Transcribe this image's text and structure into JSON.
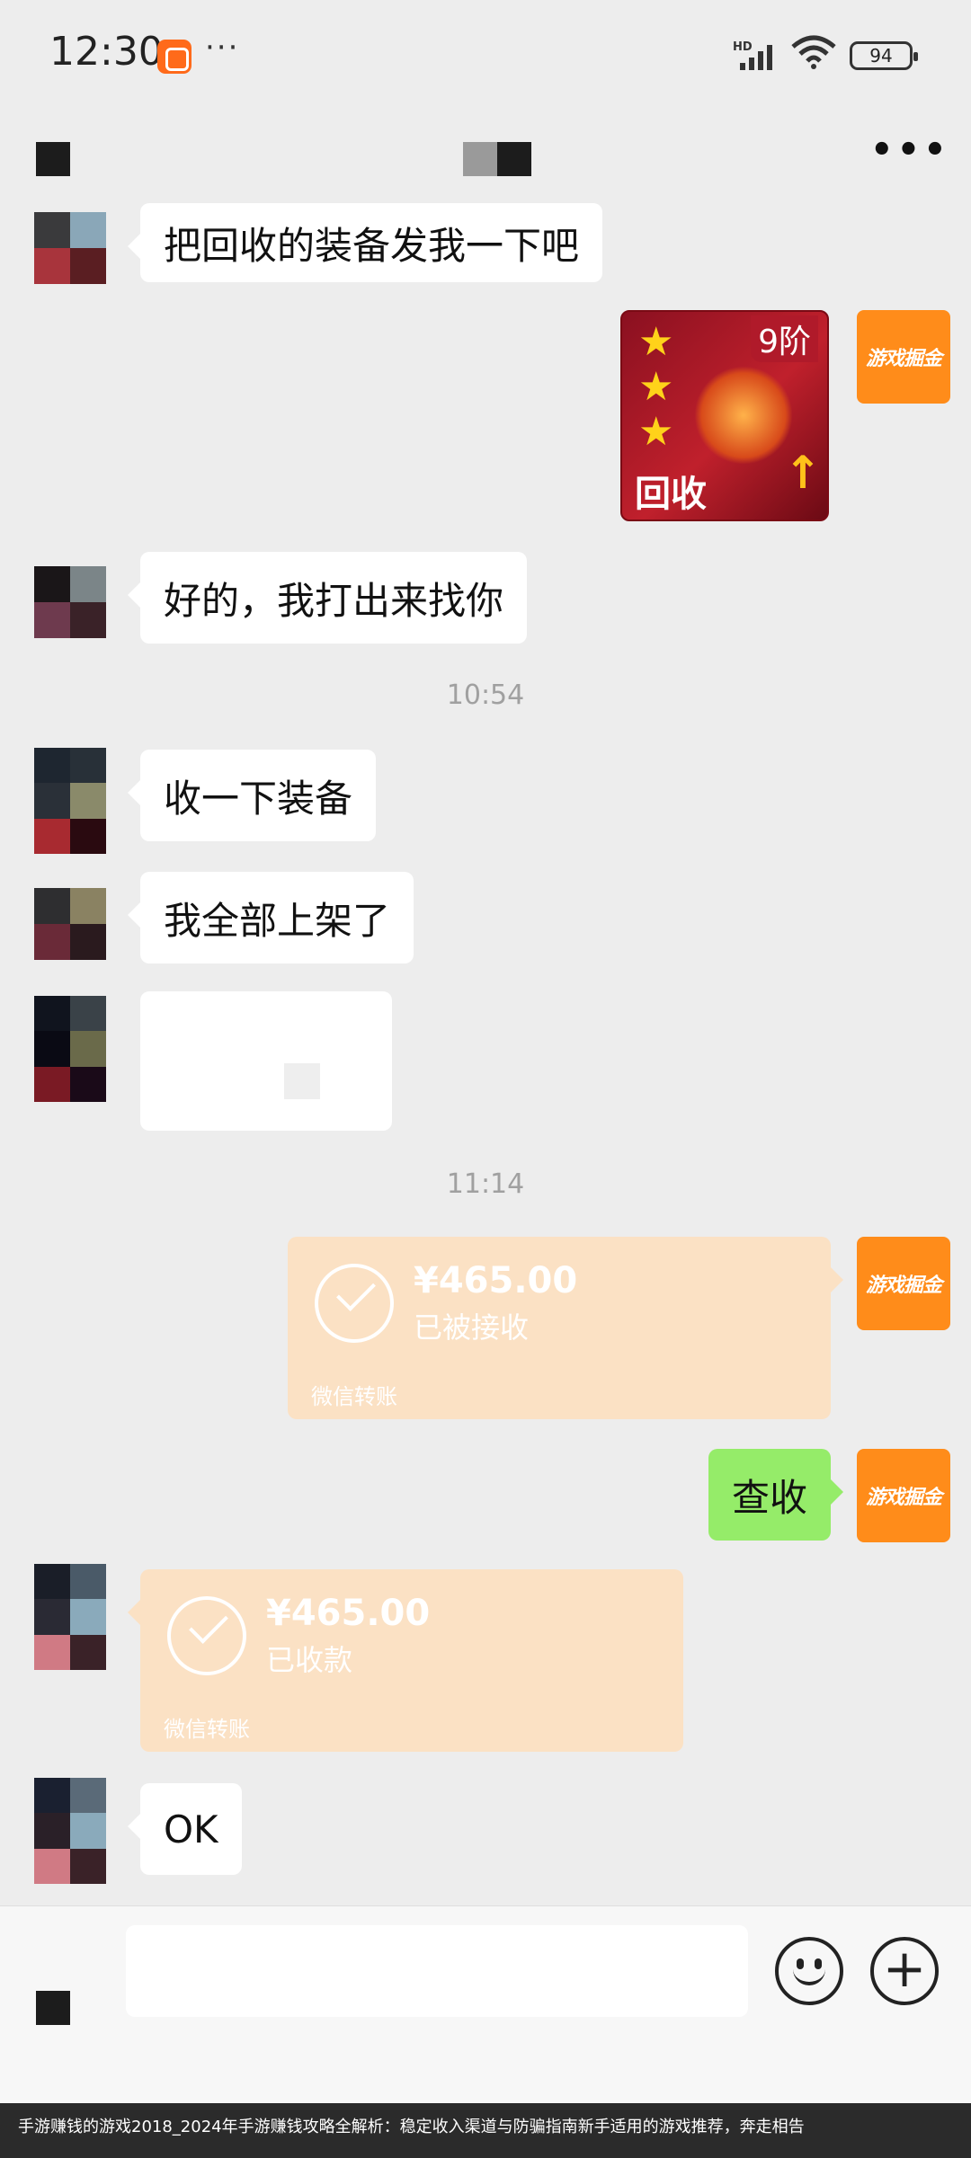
{
  "status_bar": {
    "time": "12:30",
    "overflow": "···",
    "network": "HD",
    "battery": "94"
  },
  "messages": {
    "m1": "把回收的装备发我一下吧",
    "sticker_level": "9阶",
    "sticker_label": "回收",
    "m2": "好的，我打出来找你",
    "ts1": "10:54",
    "m3": "收一下装备",
    "m4": "我全部上架了",
    "ts2": "11:14",
    "transfer_out": {
      "amount": "¥465.00",
      "status": "已被接收",
      "label": "微信转账"
    },
    "m5": "查收",
    "transfer_in": {
      "amount": "¥465.00",
      "status": "已收款",
      "label": "微信转账"
    },
    "m6": "OK"
  },
  "my_avatar_label": "游戏掘金",
  "caption": "手游赚钱的游戏2018_2024年手游赚钱攻略全解析：稳定收入渠道与防骗指南新手适用的游戏推荐，奔走相告",
  "colors": {
    "bubble_out": "#95ec69",
    "bubble_in": "#ffffff",
    "transfer": "#fbe1c4",
    "avatar_me": "#ff8c1a"
  },
  "icons": [
    "back-icon",
    "more-icon",
    "voice-icon",
    "emoji-icon",
    "plus-icon",
    "check-icon"
  ]
}
